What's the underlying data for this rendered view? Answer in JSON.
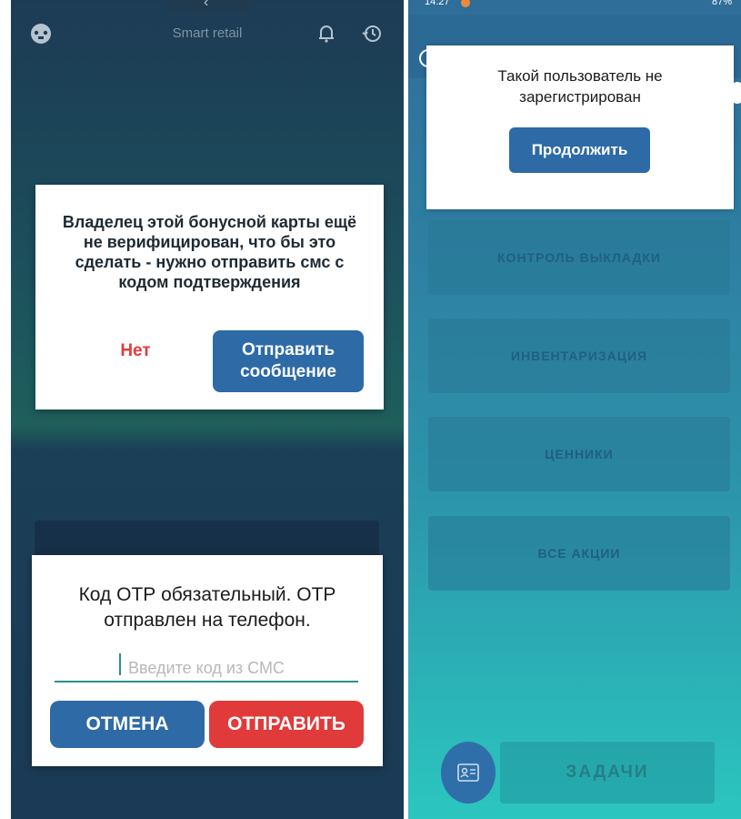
{
  "left": {
    "app_title": "Smart retail",
    "icons": [
      "gamepad-icon",
      "bell-icon",
      "history-icon",
      "back-chevron-icon"
    ],
    "dialog_verify": {
      "message": "Владелец этой бонусной карты ещё не верифицирован, что бы это сделать - нужно отправить смс с кодом подтверждения",
      "no_label": "Нет",
      "send_label": "Отправить сообщение"
    },
    "dialog_otp": {
      "message": "Код ОТР обязательный. ОТР отправлен на телефон.",
      "input_placeholder": "Введите код из СМС",
      "cancel_label": "ОТМЕНА",
      "submit_label": "ОТПРАВИТЬ"
    }
  },
  "right": {
    "status_time": "14:27",
    "status_right": "87%",
    "dialog_unregistered": {
      "message": "Такой пользователь не зарегистрирован",
      "continue_label": "Продолжить"
    },
    "menu": [
      {
        "label": "КОНТРОЛЬ ВЫКЛАДКИ"
      },
      {
        "label": "ИНВЕНТАРИЗАЦИЯ"
      },
      {
        "label": "ЦЕННИКИ"
      },
      {
        "label": "ВСЕ АКЦИИ"
      }
    ],
    "tasks_label": "ЗАДАЧИ",
    "fab_icon": "contact-card-icon"
  },
  "colors": {
    "primary_blue": "#2d6aa6",
    "danger_red": "#e03a3a",
    "teal_accent": "#2b8f8a"
  }
}
